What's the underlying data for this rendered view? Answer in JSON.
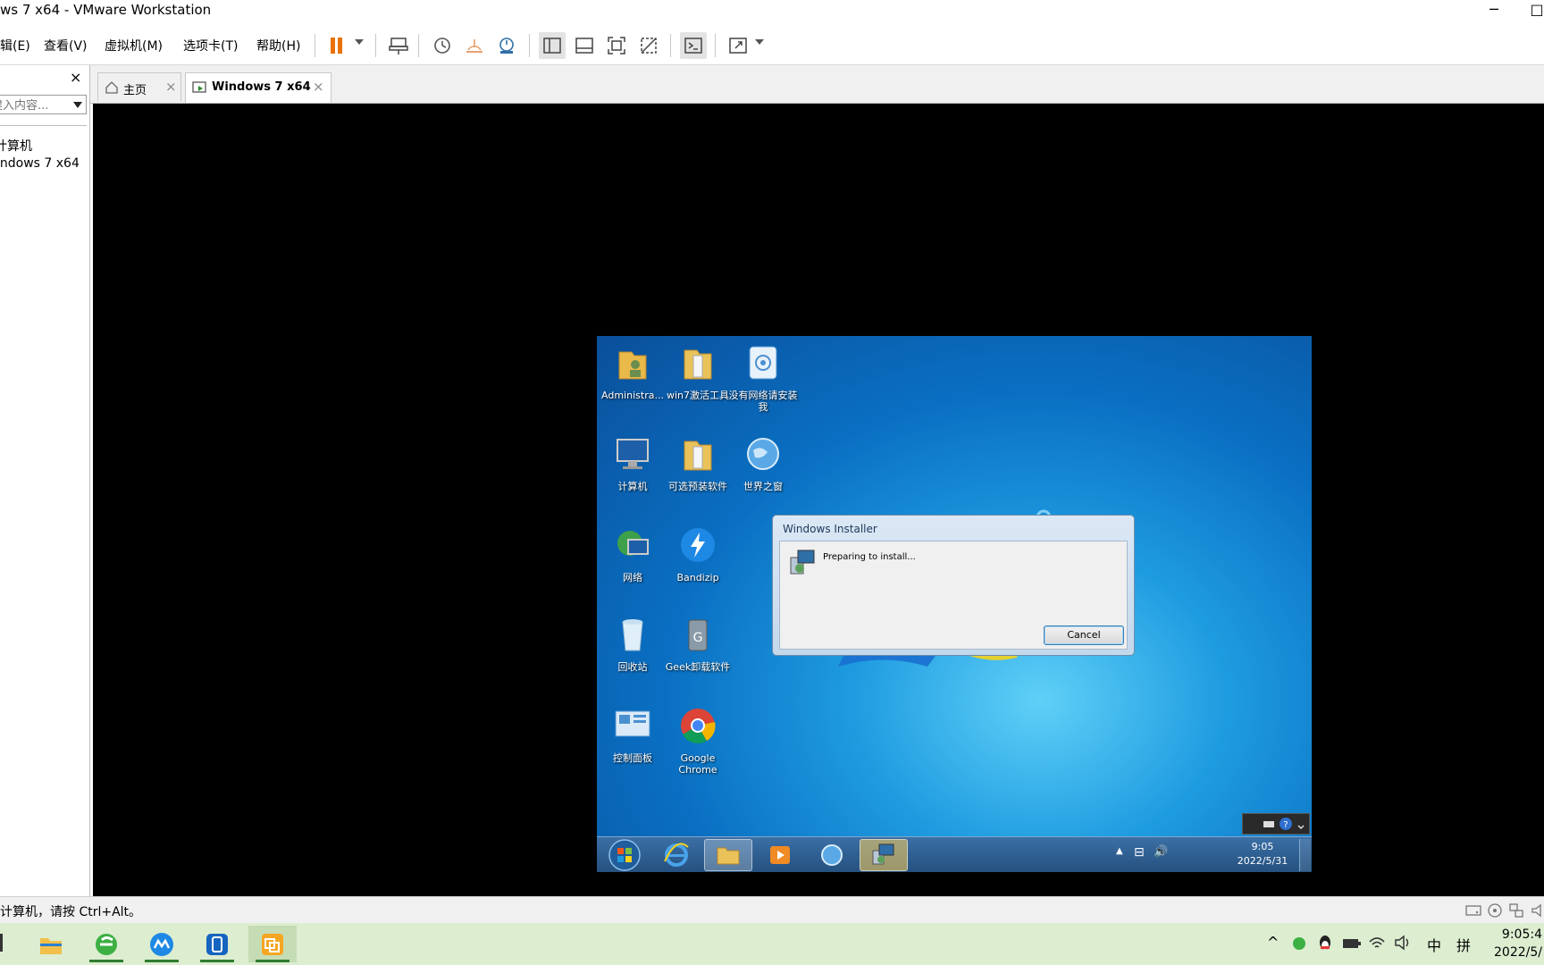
{
  "window": {
    "title": "ws 7 x64 - VMware Workstation",
    "minimize_glyph": "─",
    "restore_glyph": "□"
  },
  "menu": {
    "items": [
      "辑(E)",
      "查看(V)",
      "虚拟机(M)",
      "选项卡(T)",
      "帮助(H)"
    ]
  },
  "toolbar": {
    "icons": [
      "pause-icon",
      "send-ctrl-alt-del-icon",
      "snapshot-icon",
      "revert-snapshot-icon",
      "snapshot-manager-icon",
      "library-view-icon",
      "thumbnail-view-icon",
      "fullscreen-icon",
      "unity-icon",
      "console-view-icon",
      "stretch-icon"
    ],
    "pause_color": "#e8710a"
  },
  "sidebar": {
    "close_glyph": "×",
    "search_placeholder": "建入内容...",
    "tree": [
      "计算机",
      "indows 7 x64"
    ]
  },
  "tabs": [
    {
      "label": "主页",
      "icon": "home-icon",
      "close": "×"
    },
    {
      "label": "Windows 7 x64",
      "icon": "vm-icon",
      "close": "×"
    }
  ],
  "guest": {
    "desktop_icons": [
      {
        "label": "Administra...",
        "icon": "user-folder-icon"
      },
      {
        "label": "win7激活工具",
        "icon": "folder-icon"
      },
      {
        "label": "没有网络请安装我",
        "icon": "installer-icon"
      },
      {
        "label": "计算机",
        "icon": "computer-icon"
      },
      {
        "label": "可选预装软件",
        "icon": "folder-icon"
      },
      {
        "label": "世界之窗",
        "icon": "browser-icon"
      },
      {
        "label": "网络",
        "icon": "network-icon"
      },
      {
        "label": "Bandizip",
        "icon": "bandizip-icon"
      },
      {
        "label": "回收站",
        "icon": "recycle-bin-icon"
      },
      {
        "label": "Geek卸载软件",
        "icon": "geek-uninstaller-icon"
      },
      {
        "label": "控制面板",
        "icon": "control-panel-icon"
      },
      {
        "label": "Google Chrome",
        "icon": "chrome-icon"
      }
    ],
    "dialog": {
      "title": "Windows Installer",
      "message": "Preparing to install...",
      "cancel": "Cancel"
    },
    "clock": {
      "time": "9:05",
      "date": "2022/5/31"
    },
    "tray_glyphs": [
      "▲",
      "⊟",
      "🔊"
    ]
  },
  "statusbar": {
    "text": "计算机，请按 Ctrl+Alt。"
  },
  "host": {
    "tray": {
      "ime_lang": "中",
      "ime_mode": "拼",
      "chevron": "^"
    },
    "clock": {
      "time": "9:05:4",
      "date": "2022/5/"
    }
  }
}
